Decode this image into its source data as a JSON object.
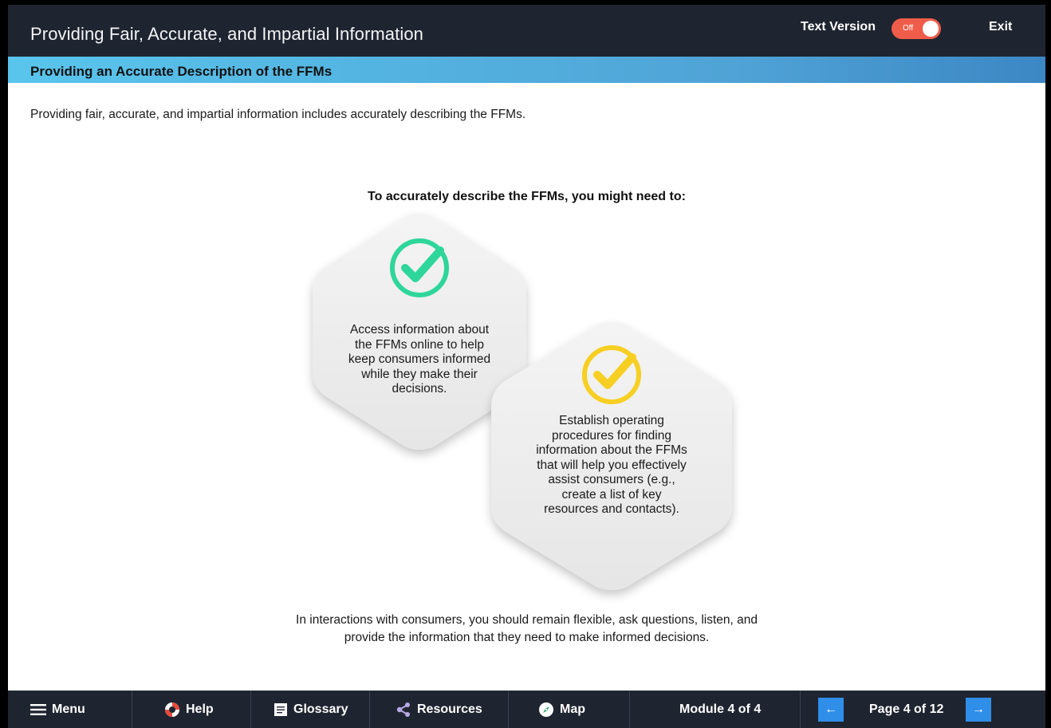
{
  "header": {
    "title": "Providing Fair, Accurate, and Impartial Information",
    "text_version_label": "Text Version",
    "toggle_state": "Off",
    "exit_label": "Exit"
  },
  "page": {
    "title": "Providing an Accurate Description of the FFMs",
    "intro": "Providing fair, accurate, and impartial information includes accurately describing the FFMs.",
    "heading": "To accurately describe the FFMs, you might need to:",
    "cards": [
      {
        "icon": "check-circle-icon",
        "color": "#2ed69b",
        "lines": [
          "Access information about",
          "the FFMs online to help",
          "keep consumers informed",
          "while they make their",
          "decisions."
        ]
      },
      {
        "icon": "check-circle-icon",
        "color": "#f7cf22",
        "lines": [
          "Establish operating",
          "procedures for finding",
          "information about the FFMs",
          "that will help you effectively",
          "assist consumers (e.g.,",
          "create a list of key",
          "resources and contacts)."
        ]
      }
    ],
    "closing": [
      "In interactions with consumers, you should remain flexible, ask questions, listen, and",
      "provide the information that they need to make informed decisions."
    ]
  },
  "nav": {
    "menu": "Menu",
    "help": "Help",
    "glossary": "Glossary",
    "resources": "Resources",
    "map": "Map",
    "module": "Module 4 of 4",
    "page": "Page 4 of 12"
  },
  "colors": {
    "bar_dark": "#1f2530",
    "accent_blue": "#2f8ee8",
    "toggle_off": "#ef5d4a"
  }
}
